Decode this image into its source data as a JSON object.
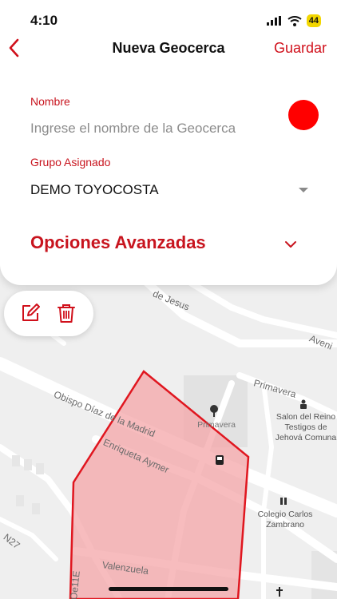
{
  "status_bar": {
    "time": "4:10",
    "battery": "44"
  },
  "nav": {
    "back_icon": "chevron-left-icon",
    "title": "Nueva Geocerca",
    "save_label": "Guardar"
  },
  "form": {
    "name_label": "Nombre",
    "name_placeholder": "Ingrese el nombre de la Geocerca",
    "name_value": "",
    "color": "#ff0000",
    "group_label": "Grupo Asignado",
    "group_value": "DEMO TOYOCOSTA",
    "advanced_label": "Opciones Avanzadas"
  },
  "tools": {
    "edit_icon": "edit-icon",
    "delete_icon": "trash-icon"
  },
  "map": {
    "streets": {
      "jesus": "de Jesus",
      "avenida": "Aveni",
      "primavera_1": "Primavera",
      "obispo": "Obispo Díaz de la Madrid",
      "enriqueta": "Enriqueta Aymer",
      "valenzuela": "Valenzuela",
      "n27": "N27",
      "oe11e": "Oe11E"
    },
    "pois": {
      "park": "Primavera",
      "salon": "Salon del Reino\nTestigos de\nJehová Comuna",
      "colegio": "Colegio Carlos\nZambrano"
    },
    "colors": {
      "accent": "#d0101b",
      "geofence_fill": "#f4a6a8",
      "geofence_stroke": "#e0161f"
    }
  }
}
